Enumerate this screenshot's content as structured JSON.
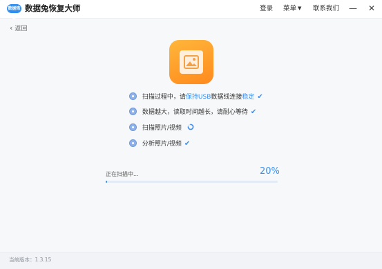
{
  "app": {
    "logo_text": "数据恢复",
    "title": "数据兔恢复大师"
  },
  "header": {
    "login_label": "登录",
    "menu_label": "菜单",
    "contact_label": "联系我们",
    "minimize_symbol": "—",
    "close_symbol": "✕"
  },
  "back": {
    "label": "返回",
    "icon": "chevron-left-icon"
  },
  "hero": {
    "icon": "image-icon",
    "colors": [
      "#ffb63b",
      "#ff8a1d"
    ]
  },
  "steps": [
    {
      "text_prefix": "扫描过程中，请",
      "text_highlight": "保持USB",
      "text_middle": "数据线连接",
      "text_highlight2": "稳定",
      "status": "done"
    },
    {
      "text": "数据越大，读取时间越长，请耐心等待",
      "status": "done"
    },
    {
      "text": "扫描照片/视频",
      "status": "in-progress"
    },
    {
      "text": "分析照片/视频",
      "status": "done"
    }
  ],
  "progress": {
    "label": "正在扫描中...",
    "percent_text": "20%",
    "fill_fraction": 0.01
  },
  "footer": {
    "version_text": "当前版本：1.3.15"
  },
  "colors": {
    "accent": "#3b8ff0",
    "hero_orange": "#ff9a2a"
  }
}
